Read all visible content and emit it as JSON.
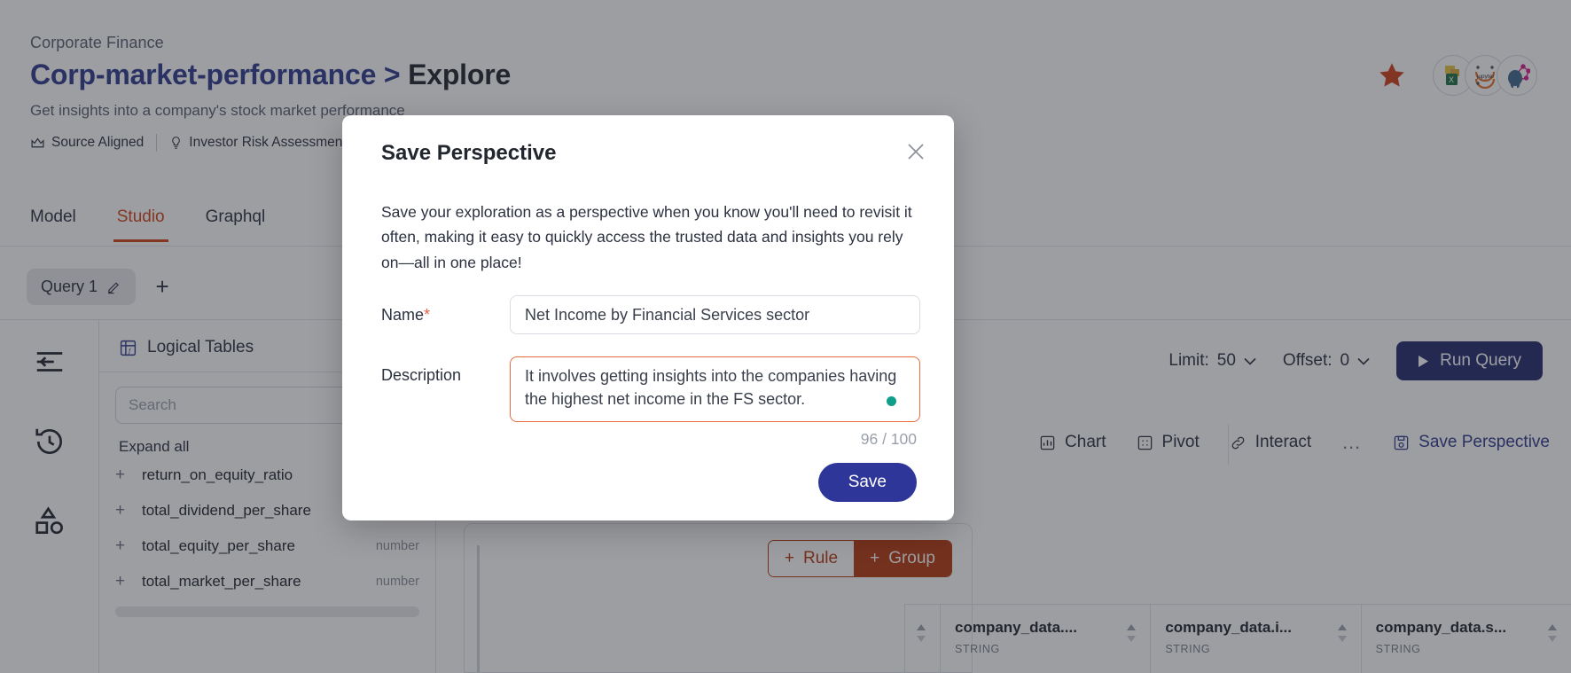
{
  "header": {
    "breadcrumb": "Corporate Finance",
    "title_project": "Corp-market-performance",
    "title_separator": ">",
    "title_leaf": "Explore",
    "subtitle": "Get insights into a company's stock market performance",
    "tags": [
      {
        "icon": "crown-icon",
        "label": "Source Aligned"
      },
      {
        "icon": "bulb-icon",
        "label": "Investor Risk Assessment"
      }
    ],
    "star_icon": "star-icon",
    "star_color": "#d0401b",
    "app_icons": [
      {
        "name": "excel-icon",
        "label": "X"
      },
      {
        "name": "jupyter-icon",
        "label": "jupyter"
      },
      {
        "name": "postgres-graphql-icon",
        "label": ""
      }
    ]
  },
  "tabs": [
    {
      "label": "Model",
      "active": false
    },
    {
      "label": "Studio",
      "active": true
    },
    {
      "label": "Graphql",
      "active": false
    }
  ],
  "querybar": {
    "chip_label": "Query 1",
    "edit_icon": "pencil-icon",
    "add_label": "+"
  },
  "rail": {
    "items": [
      {
        "name": "collapse-panel-icon"
      },
      {
        "name": "history-icon"
      },
      {
        "name": "shapes-icon"
      }
    ]
  },
  "logical_tables": {
    "heading": "Logical Tables",
    "heading_icon": "table-function-icon",
    "search_placeholder": "Search",
    "expand_all": "Expand all",
    "fields": [
      {
        "name": "return_on_equity_ratio",
        "type": ""
      },
      {
        "name": "total_dividend_per_share",
        "type": ""
      },
      {
        "name": "total_equity_per_share",
        "type": "number"
      },
      {
        "name": "total_market_per_share",
        "type": "number"
      }
    ]
  },
  "toolbar": {
    "limit_label": "Limit:",
    "limit_value": "50",
    "offset_label": "Offset:",
    "offset_value": "0",
    "run_query": "Run Query",
    "run_icon": "play-icon"
  },
  "toolbar2": {
    "chart": "Chart",
    "chart_icon": "chart-icon",
    "pivot": "Pivot",
    "pivot_icon": "pivot-icon",
    "interact": "Interact",
    "interact_icon": "link-icon",
    "more": "…",
    "save_perspective": "Save Perspective",
    "save_perspective_icon": "save-disk-icon"
  },
  "query_builder": {
    "rule_label": "Rule",
    "group_label": "Group",
    "plus": "+"
  },
  "results": {
    "columns": [
      {
        "name": "company_data....",
        "type": "STRING"
      },
      {
        "name": "company_data.i...",
        "type": "STRING"
      },
      {
        "name": "company_data.s...",
        "type": "STRING"
      }
    ]
  },
  "modal": {
    "title": "Save Perspective",
    "close_icon": "close-icon",
    "description": "Save your exploration as a perspective when you know you'll need to revisit it often, making it easy to quickly access the trusted data and insights you rely on—all in one place!",
    "name_label": "Name",
    "name_required": "*",
    "name_value": "Net Income by Financial Services sector",
    "desc_label": "Description",
    "desc_value": "It involves getting insights into the companies having the highest net income in the FS sector.",
    "counter": "96 / 100",
    "save_label": "Save",
    "accent_color": "#2f3699",
    "focus_border_color": "#e86b3f",
    "status_dot_color": "#109e8a"
  }
}
